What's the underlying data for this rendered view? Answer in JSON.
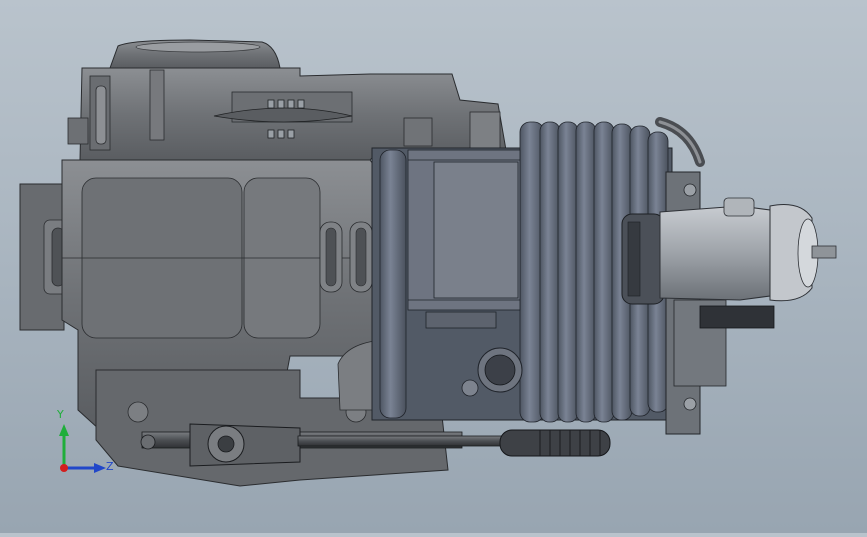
{
  "triad": {
    "y_label": "Y",
    "z_label": "Z",
    "colors": {
      "y": "#1fae3a",
      "z": "#2147c9",
      "x": "#d21e1e"
    }
  }
}
